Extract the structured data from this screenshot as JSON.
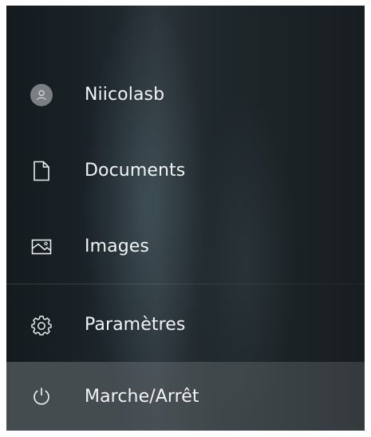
{
  "menu": {
    "items": [
      {
        "id": "user",
        "label": "Niicolasb",
        "icon": "avatar-person-icon"
      },
      {
        "id": "documents",
        "label": "Documents",
        "icon": "document-icon"
      },
      {
        "id": "images",
        "label": "Images",
        "icon": "image-icon"
      },
      {
        "id": "settings",
        "label": "Paramètres",
        "icon": "gear-icon"
      },
      {
        "id": "power",
        "label": "Marche/Arrêt",
        "icon": "power-icon"
      }
    ]
  },
  "colors": {
    "text": "#f2f4f5",
    "icon": "#e8ecee",
    "avatar_bg": "#7b7f82",
    "highlight": "#6e767a"
  }
}
